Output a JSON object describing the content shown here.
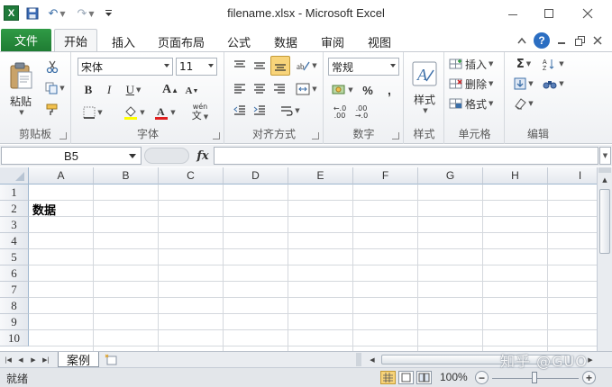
{
  "window": {
    "title": "filename.xlsx  -  Microsoft Excel",
    "app_icon_letter": "X"
  },
  "ribbon_tabs": [
    {
      "label": "文件"
    },
    {
      "label": "开始"
    },
    {
      "label": "插入"
    },
    {
      "label": "页面布局"
    },
    {
      "label": "公式"
    },
    {
      "label": "数据"
    },
    {
      "label": "审阅"
    },
    {
      "label": "视图"
    }
  ],
  "ribbon": {
    "clipboard": {
      "label": "剪贴板",
      "paste_label": "粘贴"
    },
    "font": {
      "label": "字体",
      "font_name": "宋体",
      "font_size": "11",
      "bold": "B",
      "italic": "I",
      "underline": "U",
      "grow": "A",
      "shrink": "A",
      "phonetic": "wén"
    },
    "alignment": {
      "label": "对齐方式"
    },
    "number": {
      "label": "数字",
      "format": "常规",
      "percent": "%",
      "comma": ",",
      "dec_inc": ".00",
      "dec_dec": ".00"
    },
    "styles": {
      "label": "样式",
      "button_label": "样式"
    },
    "cells": {
      "label": "单元格",
      "insert_label": "插入",
      "delete_label": "删除",
      "format_label": "格式"
    },
    "editing": {
      "label": "编辑"
    }
  },
  "formula_bar": {
    "name_box": "B5",
    "fx": "fx",
    "content": ""
  },
  "grid": {
    "columns": [
      "A",
      "B",
      "C",
      "D",
      "E",
      "F",
      "G",
      "H",
      "I"
    ],
    "rows": [
      "1",
      "2",
      "3",
      "4",
      "5",
      "6",
      "7",
      "8",
      "9",
      "10"
    ],
    "cell_a2": "数据"
  },
  "sheets": [
    {
      "name": "案例"
    }
  ],
  "status": {
    "text": "就绪",
    "zoom": "100%"
  },
  "watermark": "知乎 @GUO",
  "colors": {
    "accent_green": "#1f7c33",
    "selection_gold": "#f8d47a",
    "ribbon_blue": "#3c6fa8"
  }
}
